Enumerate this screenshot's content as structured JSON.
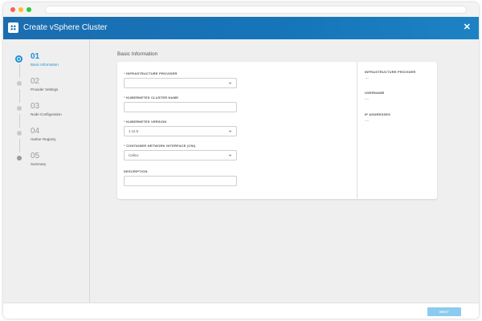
{
  "header": {
    "title": "Create vSphere Cluster",
    "close_icon": "close-icon",
    "logo_icon": "vmware-logo-icon"
  },
  "steps": [
    {
      "number": "01",
      "label": "Basic Information",
      "active": true
    },
    {
      "number": "02",
      "label": "Provider Settings",
      "active": false
    },
    {
      "number": "03",
      "label": "Node Configuration",
      "active": false
    },
    {
      "number": "04",
      "label": "Harbor Registry",
      "active": false
    },
    {
      "number": "05",
      "label": "Summary",
      "active": false
    }
  ],
  "main": {
    "section_title": "Basic Information",
    "fields": {
      "infrastructure_provider": {
        "label": "INFRASTRUCTURE PROVIDER",
        "required": "*",
        "value": ""
      },
      "cluster_name": {
        "label": "KUBERNETES CLUSTER NAME",
        "required": "*",
        "value": ""
      },
      "kubernetes_version": {
        "label": "KUBERNETES VERSION",
        "required": "*",
        "value": "1.11.5"
      },
      "cni": {
        "label": "CONTAINER NETWORK INTERFACE (CNI)",
        "required": "*",
        "value": "Calico"
      },
      "description": {
        "label": "DESCRIPTION",
        "value": ""
      }
    },
    "info_panel": {
      "infrastructure_provider": {
        "label": "INFRASTRUCTURE PROVIDER",
        "value": "---"
      },
      "username": {
        "label": "USERNAME",
        "value": "---"
      },
      "ip_addresses": {
        "label": "IP ADDRESSES",
        "value": "---"
      }
    }
  },
  "footer": {
    "next_label": "NEXT"
  },
  "colors": {
    "accent": "#1b8fd6",
    "header": "#1675b9",
    "next_button": "#8ccbef"
  }
}
